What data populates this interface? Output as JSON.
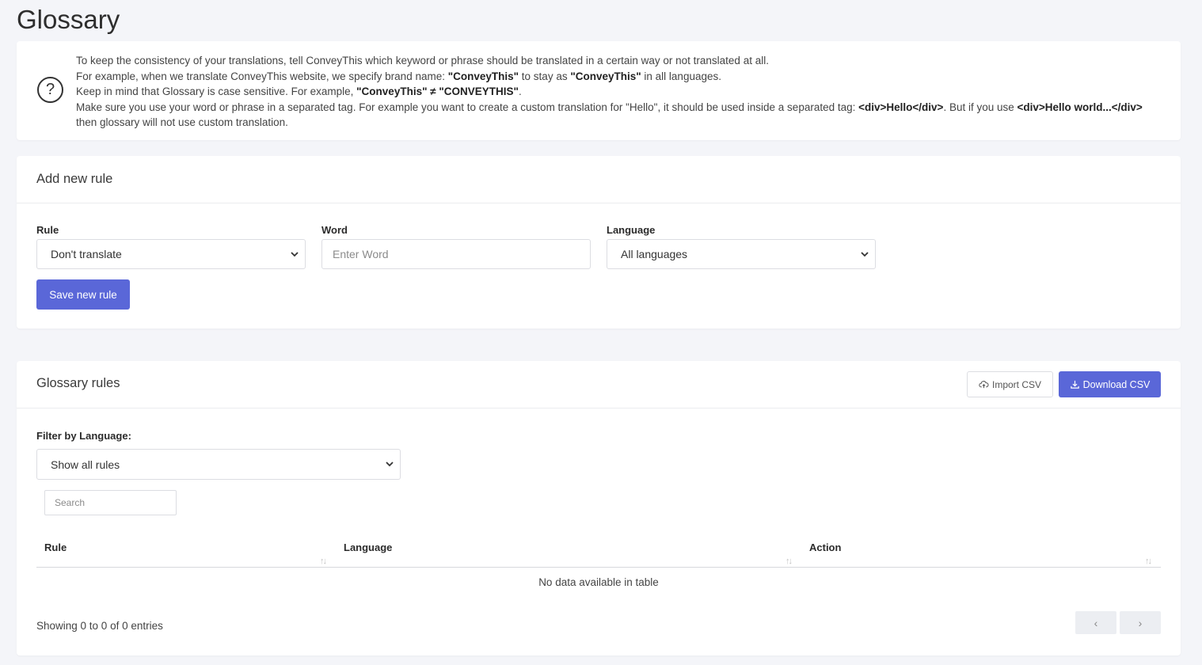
{
  "page": {
    "title": "Glossary"
  },
  "info": {
    "line1": "To keep the consistency of your translations, tell ConveyThis which keyword or phrase should be translated in a certain way or not translated at all.",
    "line2_pre": "For example, when we translate ConveyThis website, we specify brand name: ",
    "line2_b1": "\"ConveyThis\"",
    "line2_mid": " to stay as ",
    "line2_b2": "\"ConveyThis\"",
    "line2_post": " in all languages.",
    "line3_pre": "Keep in mind that Glossary is case sensitive. For example, ",
    "line3_b1": "\"ConveyThis\" ≠ \"CONVEYTHIS\"",
    "line3_post": ".",
    "line4_pre": "Make sure you use your word or phrase in a separated tag. For example you want to create a custom translation for \"Hello\", it should be used inside a separated tag: ",
    "line4_b1": "<div>Hello</div>",
    "line4_mid": ". But if you use ",
    "line4_b2": "<div>Hello world...</div>",
    "line4_post": " then glossary will not use custom translation."
  },
  "add_rule": {
    "title": "Add new rule",
    "rule_label": "Rule",
    "rule_value": "Don't translate",
    "word_label": "Word",
    "word_placeholder": "Enter Word",
    "language_label": "Language",
    "language_value": "All languages",
    "save_label": "Save new rule"
  },
  "rules": {
    "title": "Glossary rules",
    "import_label": "Import CSV",
    "download_label": "Download CSV",
    "filter_label": "Filter by Language:",
    "filter_value": "Show all rules",
    "search_placeholder": "Search",
    "columns": [
      "Rule",
      "Language",
      "Action"
    ],
    "empty_message": "No data available in table",
    "showing": "Showing 0 to 0 of 0 entries",
    "prev": "‹",
    "next": "›"
  },
  "colors": {
    "accent": "#5a67d8",
    "background": "#f4f5f9"
  }
}
